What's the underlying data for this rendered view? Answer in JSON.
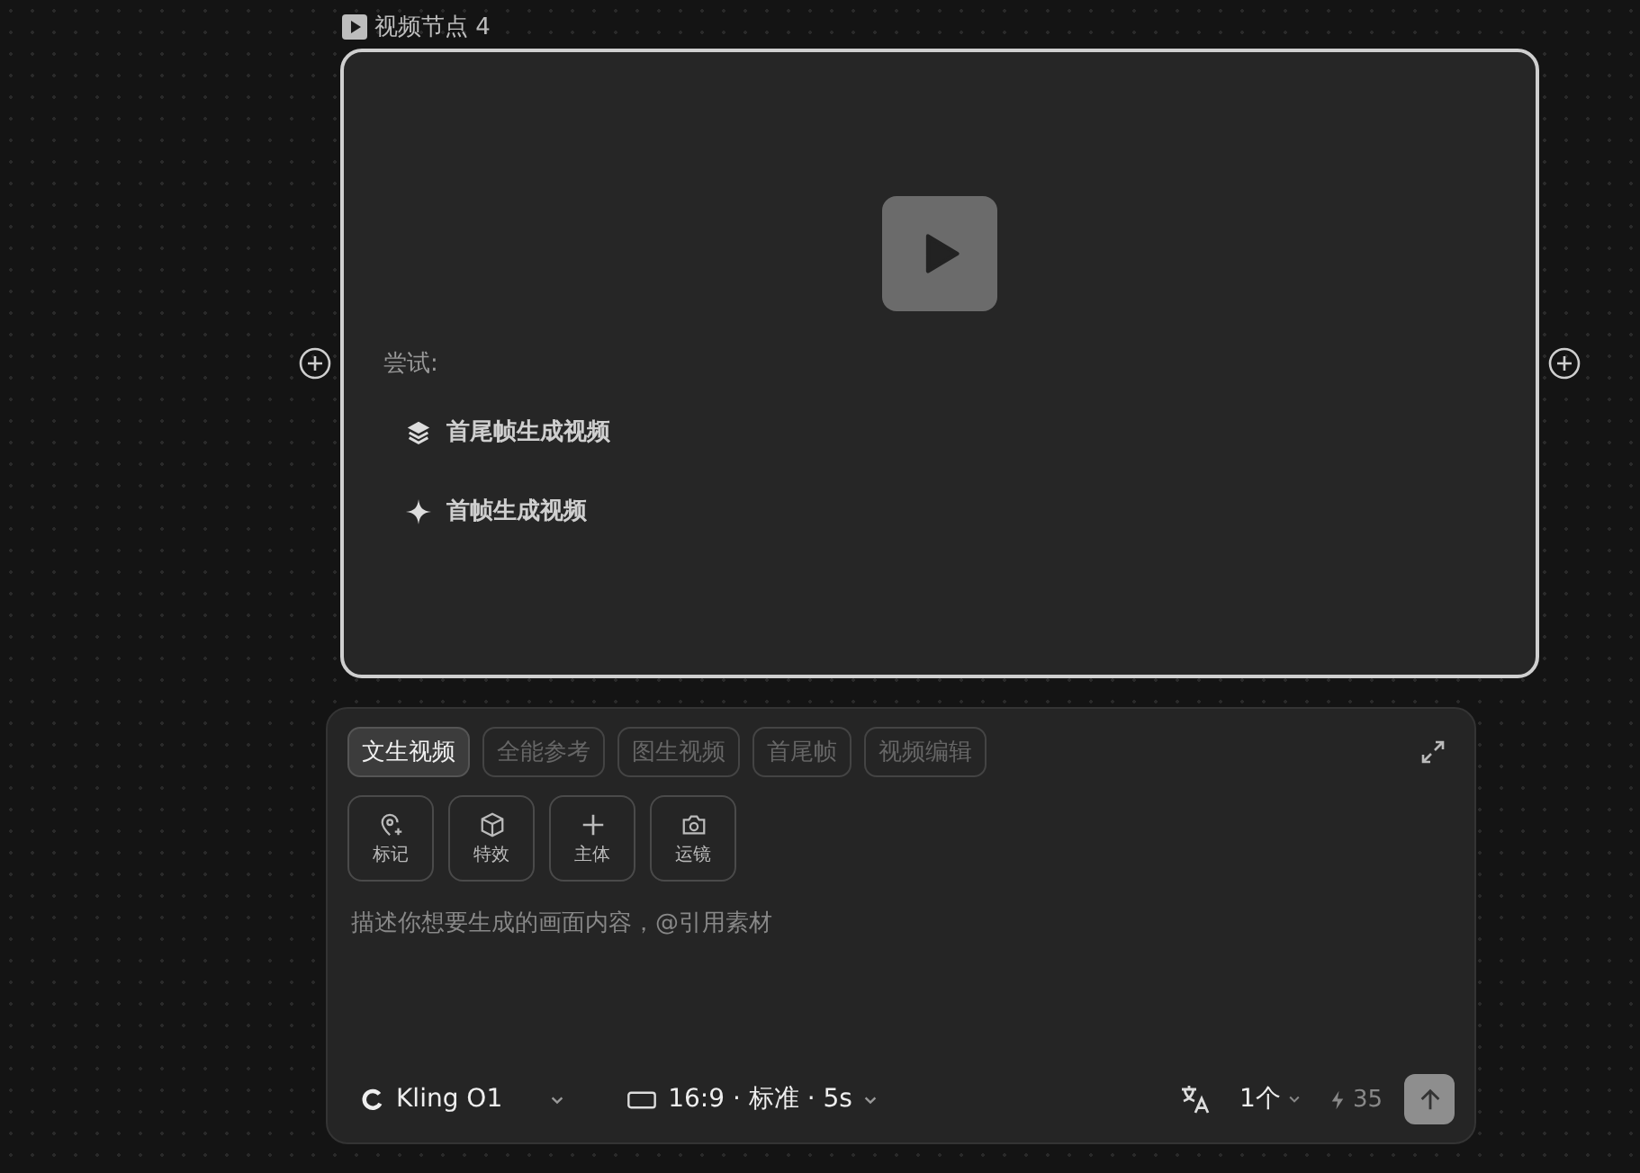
{
  "node": {
    "title": "视频节点 4",
    "try_label": "尝试:",
    "suggestions": [
      {
        "kind": "layers",
        "label": "首尾帧生成视频"
      },
      {
        "kind": "sparkle",
        "label": "首帧生成视频"
      }
    ]
  },
  "composer": {
    "tabs": [
      {
        "label": "文生视频",
        "selected": true
      },
      {
        "label": "全能参考",
        "selected": false
      },
      {
        "label": "图生视频",
        "selected": false
      },
      {
        "label": "首尾帧",
        "selected": false
      },
      {
        "label": "视频编辑",
        "selected": false
      }
    ],
    "tools": [
      {
        "kind": "pin",
        "label": "标记"
      },
      {
        "kind": "cube",
        "label": "特效"
      },
      {
        "kind": "plus",
        "label": "主体"
      },
      {
        "kind": "camera",
        "label": "运镜"
      }
    ],
    "prompt": {
      "placeholder": "描述你想要生成的画面内容，@引用素材"
    },
    "model": "Kling O1",
    "settings": "16:9 · 标准 · 5s",
    "count": "1个",
    "credits": "35"
  }
}
